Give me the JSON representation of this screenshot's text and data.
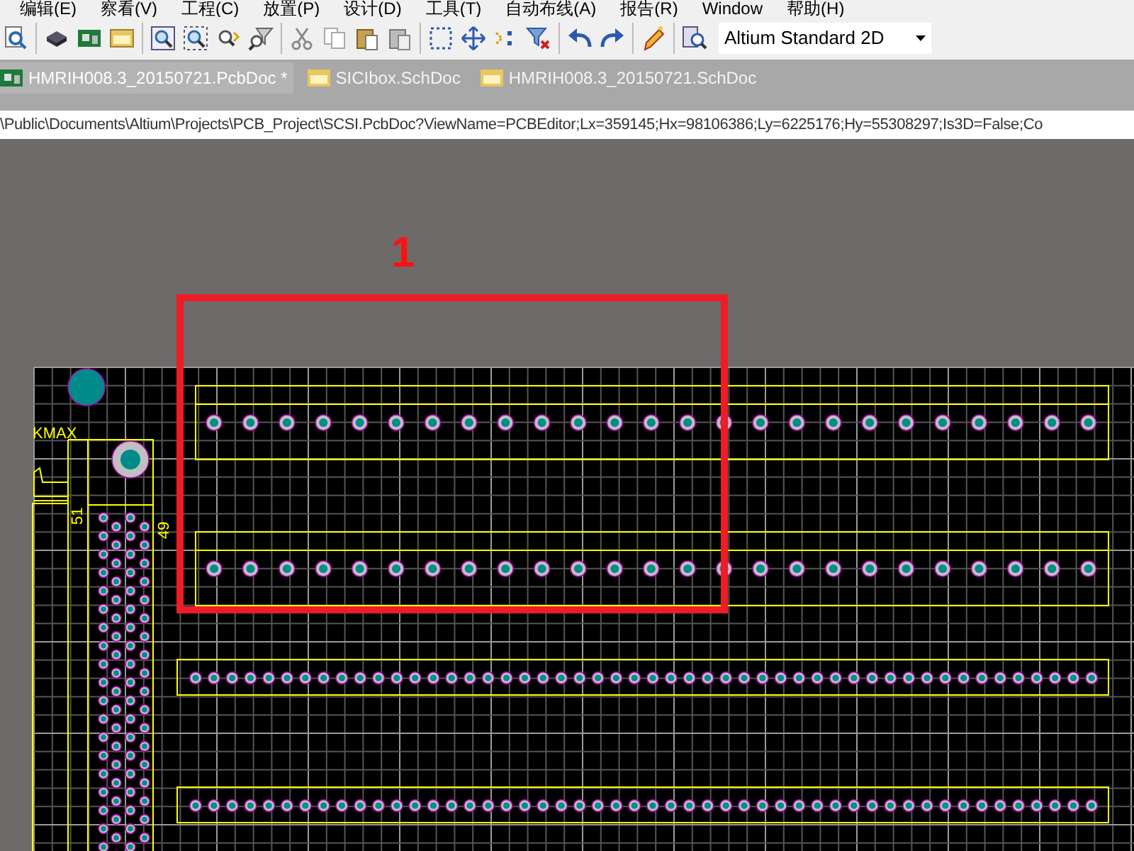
{
  "menu": [
    {
      "label": "编辑(E)"
    },
    {
      "label": "察看(V)"
    },
    {
      "label": "工程(C)"
    },
    {
      "label": "放置(P)"
    },
    {
      "label": "设计(D)"
    },
    {
      "label": "工具(T)"
    },
    {
      "label": "自动布线(A)"
    },
    {
      "label": "报告(R)"
    },
    {
      "label": "Window"
    },
    {
      "label": "帮助(H)"
    }
  ],
  "view_dropdown": {
    "value": "Altium Standard 2D"
  },
  "document_tabs": [
    {
      "label": "HMRIH008.3_20150721.PcbDoc *",
      "kind": "pcb",
      "selected": true
    },
    {
      "label": "SICIbox.SchDoc",
      "kind": "sch",
      "selected": false
    },
    {
      "label": "HMRIH008.3_20150721.SchDoc",
      "kind": "sch",
      "selected": false
    }
  ],
  "address_bar": {
    "value": "\\Public\\Documents\\Altium\\Projects\\PCB_Project\\SCSI.PcbDoc?ViewName=PCBEditor;Lx=359145;Hx=98106386;Ly=6225176;Hy=55308297;Is3D=False;Co"
  },
  "canvas": {
    "annotation_label": "1",
    "silkscreen_labels": [
      {
        "text": "KMAX",
        "kind": "horizontal"
      },
      {
        "text": "51",
        "kind": "rotated"
      },
      {
        "text": "49",
        "kind": "rotated"
      }
    ]
  }
}
